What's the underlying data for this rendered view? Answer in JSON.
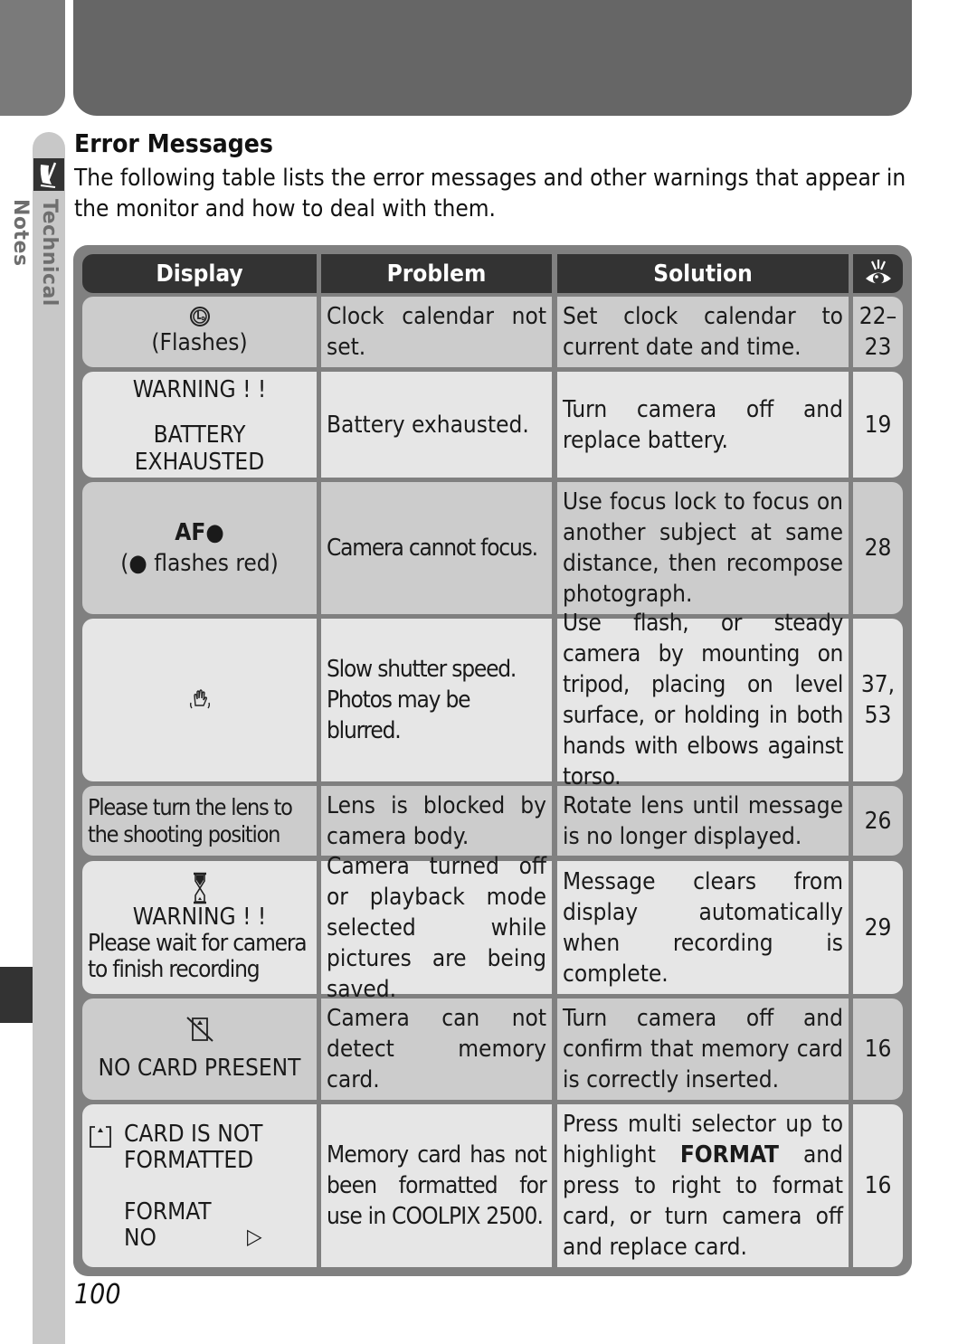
{
  "section": {
    "title": "Error Messages",
    "side_label": "Technical Notes",
    "intro": "The following table lists the error messages and other warnings that appear in the monitor and how to deal with them.",
    "page_number": "100"
  },
  "table": {
    "headers": {
      "display": "Display",
      "problem": "Problem",
      "solution": "Solution",
      "page_icon": "eye-reference-icon"
    },
    "rows": [
      {
        "icon": "clock-icon",
        "display": [
          "(Flashes)"
        ],
        "problem": "Clock calendar not set.",
        "solution": "Set clock calendar to current date and time.",
        "page": "22–23"
      },
      {
        "display": [
          "WARNING ! !",
          "BATTERY",
          "EXHAUSTED"
        ],
        "problem": "Battery exhausted.",
        "solution": "Turn camera off and replace battery.",
        "page": "19"
      },
      {
        "display": [
          "AF●",
          "(● flashes red)"
        ],
        "problem": "Camera cannot focus.",
        "solution": "Use focus lock to focus on another subject at same distance, then recompose photograph.",
        "page": "28"
      },
      {
        "icon": "camera-shake-hand-icon",
        "display": [],
        "problem": "Slow shutter speed. Photos may be blurred.",
        "solution": "Use flash, or steady camera by mounting on tripod, placing on level surface, or holding in both hands with elbows against torso.",
        "page": "37, 53"
      },
      {
        "display": [
          "Please turn the lens to the shooting position"
        ],
        "problem": "Lens is blocked by camera body.",
        "solution": "Rotate lens until message is no longer displayed.",
        "page": "26"
      },
      {
        "icon": "hourglass-icon",
        "display": [
          "WARNING ! !",
          "Please wait for camera to finish recording"
        ],
        "problem": "Camera turned off or playback mode selected while pictures are being saved.",
        "solution": "Message clears from display automatically when recording is complete.",
        "page": "29"
      },
      {
        "icon": "no-card-icon",
        "display": [
          "NO CARD PRESENT"
        ],
        "problem": "Camera can not detect memory card.",
        "solution": "Turn camera off and confirm that memory card is correctly inserted.",
        "page": "16"
      },
      {
        "icon": "card-icon",
        "display": [
          "CARD IS NOT",
          "FORMATTED",
          "FORMAT",
          "NO"
        ],
        "display_arrow": "▷",
        "problem": "Memory card has not been formatted for use in COOLPIX 2500.",
        "solution_parts": [
          "Press multi selector up to highlight ",
          "FORMAT",
          " and press to right to format card, or turn camera off and replace card."
        ],
        "page": "16"
      }
    ]
  }
}
